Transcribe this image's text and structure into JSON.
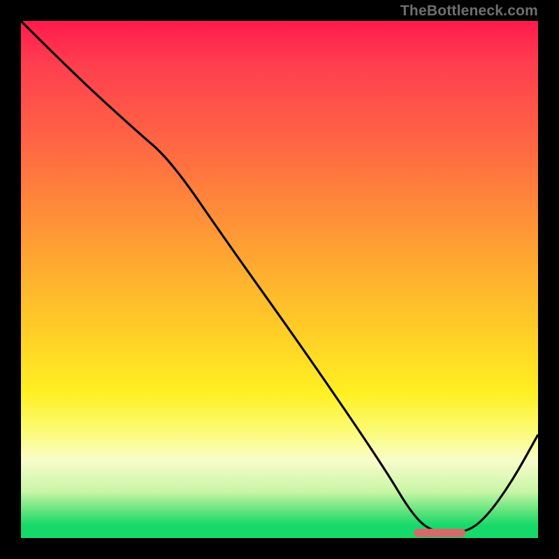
{
  "watermark": "TheBottleneck.com",
  "colors": {
    "gradient_top": "#ff1a4d",
    "gradient_mid": "#ffd326",
    "gradient_bottom": "#17d96a",
    "curve": "#000000",
    "marker": "#d46a6a",
    "frame": "#000000"
  },
  "chart_data": {
    "type": "line",
    "title": "",
    "xlabel": "",
    "ylabel": "",
    "xlim": [
      0,
      100
    ],
    "ylim": [
      0,
      100
    ],
    "grid": false,
    "legend": false,
    "series": [
      {
        "name": "curve",
        "x": [
          0,
          10,
          22,
          29,
          40,
          55,
          70,
          76,
          80,
          86,
          90,
          95,
          100
        ],
        "y": [
          100,
          90,
          79,
          73,
          57,
          36,
          14,
          4,
          1,
          1,
          4,
          11,
          20
        ]
      }
    ],
    "annotations": [
      {
        "name": "optimum-marker",
        "shape": "rounded-bar",
        "x_start": 76,
        "x_end": 86,
        "y": 1,
        "color": "#d46a6a"
      }
    ]
  }
}
